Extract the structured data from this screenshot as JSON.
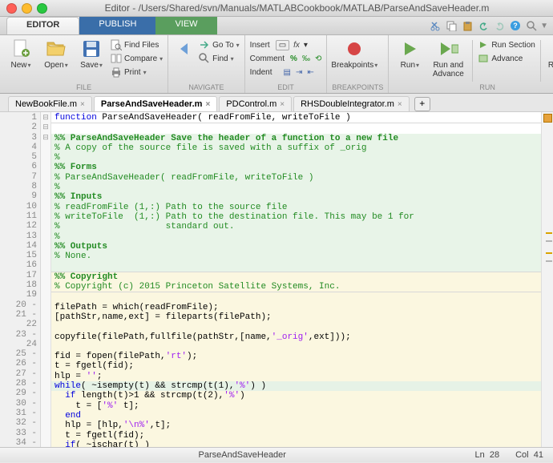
{
  "titlebar": {
    "title": "Editor - /Users/Shared/svn/Manuals/MATLABCookbook/MATLAB/ParseAndSaveHeader.m"
  },
  "ribbon_tabs": {
    "editor": "EDITOR",
    "publish": "PUBLISH",
    "view": "VIEW"
  },
  "groups": {
    "file": "FILE",
    "navigate": "NAVIGATE",
    "edit": "EDIT",
    "breakpoints": "BREAKPOINTS",
    "run": "RUN"
  },
  "toolbar": {
    "new": "New",
    "open": "Open",
    "save": "Save",
    "find_files": "Find Files",
    "compare": "Compare",
    "print": "Print",
    "goto": "Go To",
    "find": "Find",
    "comment": "Comment",
    "indent": "Indent",
    "insert": "Insert",
    "fx": "fx",
    "breakpoints": "Breakpoints",
    "run": "Run",
    "run_advance": "Run and\nAdvance",
    "run_section": "Run Section",
    "advance": "Advance",
    "run_time": "Run and\nTime"
  },
  "file_tabs": [
    {
      "label": "NewBookFile.m"
    },
    {
      "label": "ParseAndSaveHeader.m"
    },
    {
      "label": "PDControl.m"
    },
    {
      "label": "RHSDoubleIntegrator.m"
    }
  ],
  "code_lines": [
    {
      "n": "1",
      "f": "⊟",
      "cls": "",
      "html": "<span class='kw'>function</span> <span class='txt'>ParseAndSaveHeader( readFromFile, writeToFile )</span>"
    },
    {
      "n": "2",
      "f": "",
      "cls": "rule",
      "html": ""
    },
    {
      "n": "3",
      "f": "⊟",
      "cls": "hl-green",
      "html": "<span class='comb'>%% ParseAndSaveHeader Save the header of a function to a new file</span>"
    },
    {
      "n": "4",
      "f": "",
      "cls": "hl-green",
      "html": "<span class='com'>% A copy of the source file is saved with a suffix of _orig</span>"
    },
    {
      "n": "5",
      "f": "",
      "cls": "hl-green",
      "html": "<span class='com'>%</span>"
    },
    {
      "n": "6",
      "f": "",
      "cls": "hl-green",
      "html": "<span class='comb'>%% Forms</span>"
    },
    {
      "n": "7",
      "f": "",
      "cls": "hl-green",
      "html": "<span class='com'>% ParseAndSaveHeader( readFromFile, writeToFile )</span>"
    },
    {
      "n": "8",
      "f": "",
      "cls": "hl-green",
      "html": "<span class='com'>%</span>"
    },
    {
      "n": "9",
      "f": "",
      "cls": "hl-green",
      "html": "<span class='comb'>%% Inputs</span>"
    },
    {
      "n": "10",
      "f": "",
      "cls": "hl-green",
      "html": "<span class='com'>% readFromFile (1,:) Path to the source file</span>"
    },
    {
      "n": "11",
      "f": "",
      "cls": "hl-green",
      "html": "<span class='com'>% writeToFile  (1,:) Path to the destination file. This may be 1 for</span>"
    },
    {
      "n": "12",
      "f": "",
      "cls": "hl-green",
      "html": "<span class='com'>%                    standard out.</span>"
    },
    {
      "n": "13",
      "f": "",
      "cls": "hl-green",
      "html": "<span class='com'>%</span>"
    },
    {
      "n": "14",
      "f": "",
      "cls": "hl-green",
      "html": "<span class='comb'>%% Outputs</span>"
    },
    {
      "n": "15",
      "f": "",
      "cls": "hl-green",
      "html": "<span class='com'>% None.</span>"
    },
    {
      "n": "16",
      "f": "",
      "cls": "hl-green",
      "html": ""
    },
    {
      "n": "17",
      "f": "",
      "cls": "hl-yellow rule",
      "html": "<span class='comb'>%% Copyright</span>"
    },
    {
      "n": "18",
      "f": "",
      "cls": "hl-yellow",
      "html": "<span class='com'>% Copyright (c) 2015 Princeton Satellite Systems, Inc.</span>"
    },
    {
      "n": "19",
      "f": "",
      "cls": "hl-yellow rule",
      "html": ""
    },
    {
      "n": "20 -",
      "f": "",
      "cls": "hl-yellow",
      "html": "<span class='txt'>filePath = which(readFromFile);</span>"
    },
    {
      "n": "21 -",
      "f": "",
      "cls": "hl-yellow",
      "html": "<span class='txt'>[pathStr,name,ext] = fileparts(filePath);</span>"
    },
    {
      "n": "22",
      "f": "",
      "cls": "hl-yellow",
      "html": ""
    },
    {
      "n": "23 -",
      "f": "",
      "cls": "hl-yellow",
      "html": "<span class='txt'>copyfile(filePath,fullfile(pathStr,[name,</span><span class='str'>'_orig'</span><span class='txt'>,ext]));</span>"
    },
    {
      "n": "24",
      "f": "",
      "cls": "hl-yellow",
      "html": ""
    },
    {
      "n": "25 -",
      "f": "",
      "cls": "hl-yellow",
      "html": "<span class='txt'>fid = fopen(filePath,</span><span class='str'>'rt'</span><span class='txt'>);</span>"
    },
    {
      "n": "26 -",
      "f": "",
      "cls": "hl-yellow",
      "html": "<span class='txt'>t = fgetl(fid);</span>"
    },
    {
      "n": "27 -",
      "f": "",
      "cls": "hl-yellow",
      "html": "<span class='txt'>hlp = </span><span class='str'>''</span><span class='txt'>;</span>"
    },
    {
      "n": "28 -",
      "f": "⊟",
      "cls": "hl-active",
      "html": "<span class='kw'>while</span><span class='txt'>( ~isempty(t) && strcmp(t(1),</span><span class='str'>'%'</span><span class='txt'>) )</span>"
    },
    {
      "n": "29 -",
      "f": "",
      "cls": "hl-yellow",
      "html": "  <span class='kw'>if</span><span class='txt'> length(t)>1 && strcmp(t(2),</span><span class='str'>'%'</span><span class='txt'>)</span>"
    },
    {
      "n": "30 -",
      "f": "",
      "cls": "hl-yellow",
      "html": "    <span class='txt'>t = [</span><span class='str'>'%'</span><span class='txt'> t];</span>"
    },
    {
      "n": "31 -",
      "f": "",
      "cls": "hl-yellow",
      "html": "  <span class='kw'>end</span>"
    },
    {
      "n": "32 -",
      "f": "",
      "cls": "hl-yellow",
      "html": "  <span class='txt'>hlp = [hlp,</span><span class='str'>'\\n%'</span><span class='txt'>,t];</span>"
    },
    {
      "n": "33 -",
      "f": "",
      "cls": "hl-yellow",
      "html": "  <span class='txt'>t = fgetl(fid);</span>"
    },
    {
      "n": "34 -",
      "f": "",
      "cls": "hl-yellow",
      "html": "  <span class='kw'>if</span><span class='txt'>( ~ischar(t) )</span>"
    }
  ],
  "status": {
    "file": "ParseAndSaveHeader",
    "ln_label": "Ln",
    "ln": "28",
    "col_label": "Col",
    "col": "41"
  }
}
